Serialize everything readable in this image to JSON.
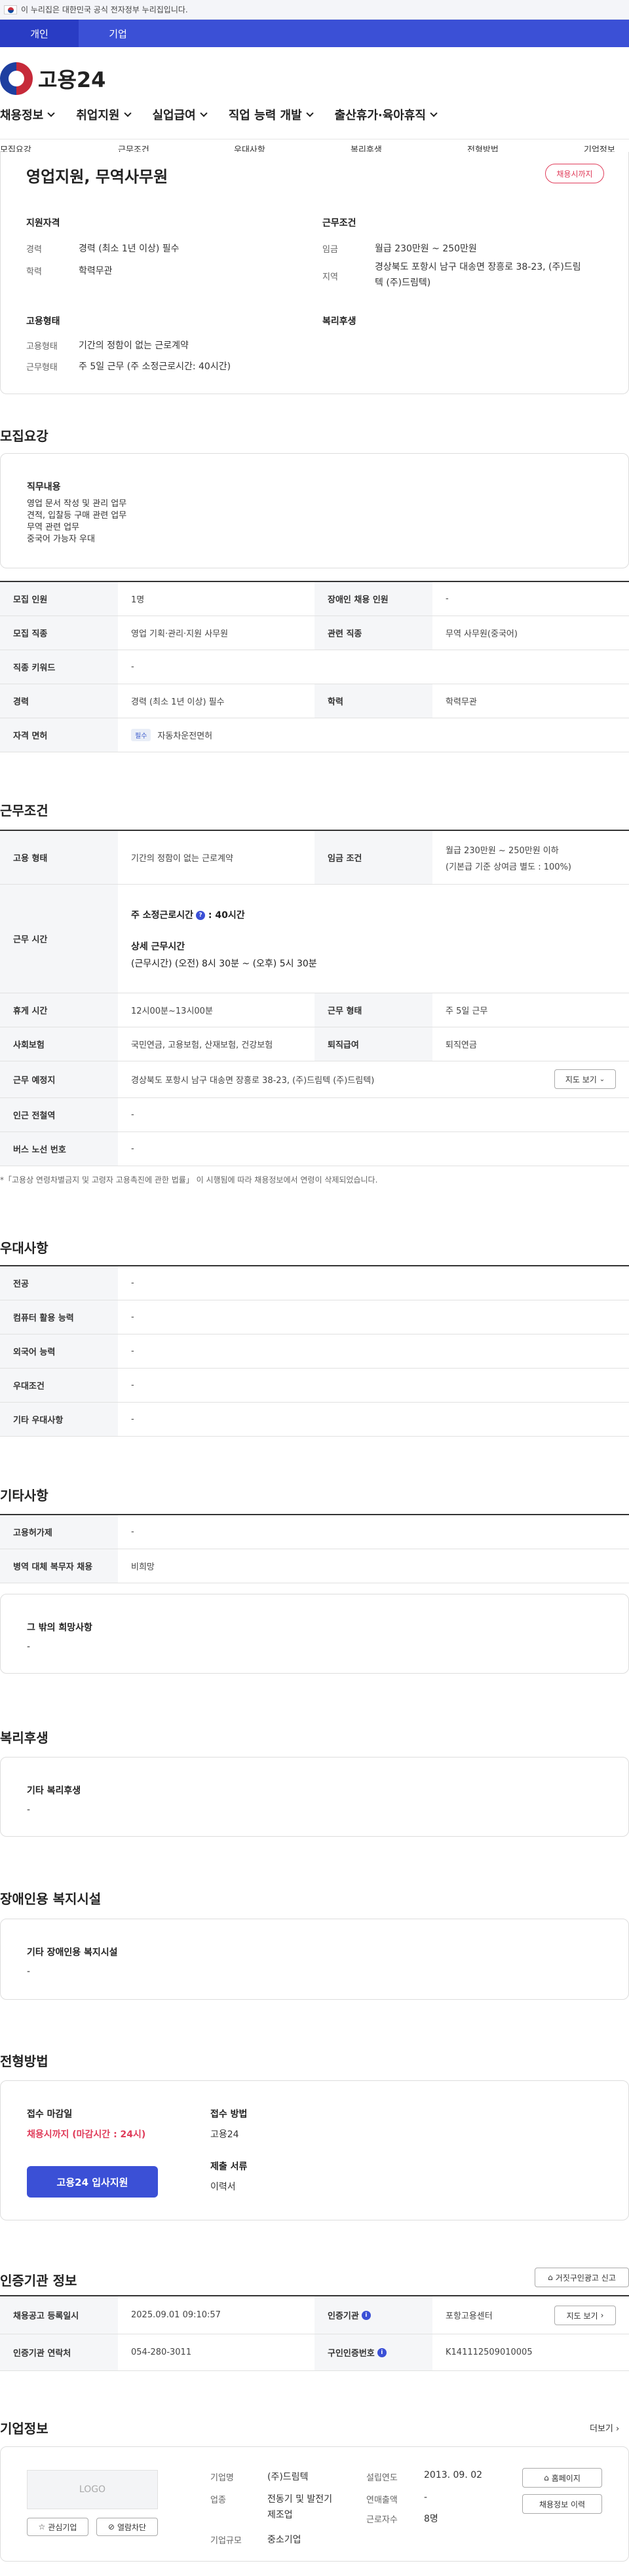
{
  "gov_notice": "이 누리집은 대한민국 공식 전자정부 누리집입니다.",
  "user_tabs": [
    "개인",
    "기업"
  ],
  "logo_text": "고용24",
  "gnb": [
    "채용정보",
    "취업지원",
    "실업급여",
    "직업 능력 개발",
    "출산휴가·육아휴직"
  ],
  "subnav": [
    "모집요강",
    "근무조건",
    "우대사항",
    "복리후생",
    "전형방법",
    "기업정보"
  ],
  "job": {
    "title": "영업지원, 무역사무원",
    "status_badge": "채용시까지",
    "qual_title": "지원자격",
    "career_label": "경력",
    "career_value": "경력 (최소 1년 이상) 필수",
    "edu_label": "학력",
    "edu_value": "학력무관",
    "work_title": "근무조건",
    "wage_label": "임금",
    "wage_value": "월급 230만원 ~ 250만원",
    "region_label": "지역",
    "region_value_1": "경상북도 포항시 남구 대송면 장흥로 38-23, (주)드림",
    "region_value_2": "텍 (주)드림텍)",
    "emp_title": "고용형태",
    "emp_label": "고용형태",
    "emp_value": "기간의 정함이 없는 근로계약",
    "workform_label": "근무형태",
    "workform_value": "주 5일 근무 (주 소정근로시간: 40시간)",
    "welfare_title": "복리후생"
  },
  "recruit": {
    "section_title": "모집요강",
    "duty_title": "직무내용",
    "duty_lines": [
      "영업 문서 작성 및 관리 업무",
      "견적, 입찰등 구매 관련 업무",
      "무역 관련 업무",
      "중국어 가능자 우대"
    ],
    "rows": [
      {
        "l1": "모집 인원",
        "v1": "1명",
        "l2": "장애인 채용 인원",
        "v2": "-"
      },
      {
        "l1": "모집 직종",
        "v1": "영업 기획·관리·지원 사무원",
        "l2": "관련 직종",
        "v2": "무역 사무원(중국어)"
      },
      {
        "l1": "직종 키워드",
        "v1": "-"
      },
      {
        "l1": "경력",
        "v1": "경력 (최소 1년 이상) 필수",
        "l2": "학력",
        "v2": "학력무관"
      },
      {
        "l1": "자격 면허",
        "tag": "필수",
        "v1": "자동차운전면허"
      }
    ]
  },
  "conditions": {
    "section_title": "근무조건",
    "emp_label": "고용 형태",
    "emp_value": "기간의 정함이 없는 근로계약",
    "wage_label": "임금 조건",
    "wage_value_1": "월급 230만원 ~ 250만원 이하",
    "wage_value_2": "(기본급 기준 상여금 별도 : 100%)",
    "time_label": "근무 시간",
    "time_main": "주 소정근로시간",
    "time_main_value": ": 40시간",
    "time_detail_title": "상세 근무시간",
    "time_detail_value": "(근무시간) (오전) 8시 30분 ~ (오후) 5시 30분",
    "rest_label": "휴게 시간",
    "rest_value": "12시00분~13시00분",
    "workform_label": "근무 형태",
    "workform_value": "주 5일 근무",
    "insurance_label": "사회보험",
    "insurance_value": "국민연금, 고용보험, 산재보험, 건강보험",
    "retire_label": "퇴직급여",
    "retire_value": "퇴직연금",
    "place_label": "근무 예정지",
    "place_value": "경상북도 포항시 남구 대송면 장흥로 38-23, (주)드림텍 (주)드림텍)",
    "map_button": "지도 보기",
    "subway_label": "인근 전철역",
    "subway_value": "-",
    "bus_label": "버스 노선 번호",
    "bus_value": "-",
    "note": "*「고용상 연령차별금지 및 고령자 고용촉진에 관한 법률」 이 시행됨에 따라 채용정보에서 연령이 삭제되었습니다."
  },
  "preference": {
    "section_title": "우대사항",
    "rows": [
      {
        "label": "전공",
        "value": "-"
      },
      {
        "label": "컴퓨터 활용 능력",
        "value": "-"
      },
      {
        "label": "외국어 능력",
        "value": "-"
      },
      {
        "label": "우대조건",
        "value": "-"
      },
      {
        "label": "기타 우대사항",
        "value": "-"
      }
    ]
  },
  "other": {
    "section_title": "기타사항",
    "rows": [
      {
        "label": "고용허가제",
        "value": "-"
      },
      {
        "label": "병역 대체 복무자 채용",
        "value": "비희망"
      }
    ],
    "extra_title": "그 밖의 희망사항",
    "extra_value": "-"
  },
  "welfare": {
    "section_title": "복리후생",
    "box_title": "기타 복리후생",
    "box_value": "-"
  },
  "disabled": {
    "section_title": "장애인용 복지시설",
    "box_title": "기타 장애인용 복지시설",
    "box_value": "-"
  },
  "selection": {
    "section_title": "전형방법",
    "deadline_label": "접수 마감일",
    "deadline_value": "채용시까지 (마감시간 : 24시)",
    "apply_button": "고용24 입사지원",
    "method_label": "접수 방법",
    "method_value": "고용24",
    "docs_label": "제출 서류",
    "docs_value": "이력서"
  },
  "cert": {
    "section_title": "인증기관 정보",
    "report_button": "거짓구인광고 신고",
    "reg_label": "채용공고 등록일시",
    "reg_value": "2025.09.01 09:10:57",
    "agency_label": "인증기관",
    "agency_value": "포항고용센터",
    "map_button": "지도 보기",
    "contact_label": "인증기관 연락처",
    "contact_value": "054-280-3011",
    "cert_no_label": "구인인증번호",
    "cert_no_value": "K141112509010005"
  },
  "company": {
    "section_title": "기업정보",
    "more": "더보기",
    "logo_placeholder": "LOGO",
    "interest_button": "관심기업",
    "block_button": "열람차단",
    "name_label": "기업명",
    "name_value": "(주)드림텍",
    "est_label": "설립연도",
    "est_value": "2013. 09. 02",
    "industry_label": "업종",
    "industry_value_1": "전동기 및 발전기",
    "industry_value_2": "제조업",
    "sales_label": "연매출액",
    "sales_value": "-",
    "employees_label": "근로자수",
    "employees_value": "8명",
    "size_label": "기업규모",
    "size_value": "중소기업",
    "homepage_button": "홈페이지",
    "history_button": "채용정보 이력"
  }
}
